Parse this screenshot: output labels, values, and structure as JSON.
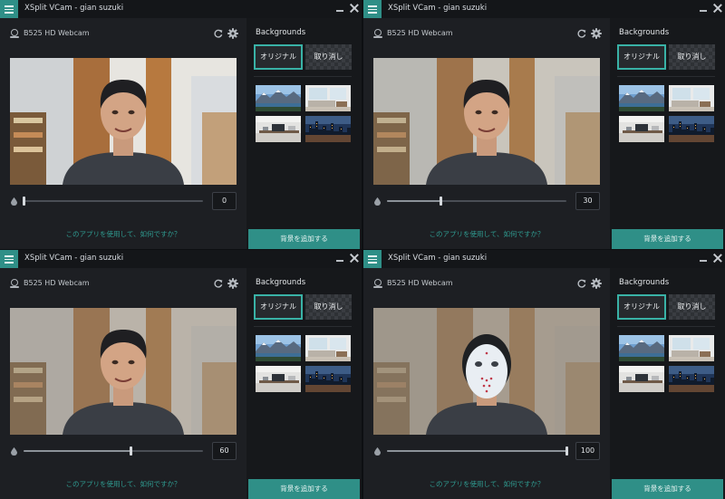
{
  "colors": {
    "accent": "#2f8f87",
    "accent_border": "#39b2a6",
    "link": "#2f9b90",
    "panel_dark": "#16181b",
    "panel": "#1d1f23"
  },
  "icons": {
    "menu": "hamburger-menu-icon",
    "minimize": "minimize-icon",
    "close": "close-icon",
    "webcam": "webcam-icon",
    "refresh": "refresh-icon",
    "settings": "gear-icon",
    "blur": "droplet-icon"
  },
  "windows": [
    {
      "title": "XSplit VCam - gian suzuki",
      "camera_name": "B525 HD Webcam",
      "blur_value": "0",
      "blur_level": 0,
      "preview": {
        "blur": 0,
        "mask": false
      },
      "feedback_text": "このアプリを使用して、如何ですか？",
      "backgrounds_title": "Backgrounds",
      "original_label": "オリジナル",
      "remove_label": "取り消し",
      "add_background_label": "背景を追加する"
    },
    {
      "title": "XSplit VCam - gian suzuki",
      "camera_name": "B525 HD Webcam",
      "blur_value": "30",
      "blur_level": 30,
      "preview": {
        "blur": 30,
        "mask": false
      },
      "feedback_text": "このアプリを使用して、如何ですか？",
      "backgrounds_title": "Backgrounds",
      "original_label": "オリジナル",
      "remove_label": "取り消し",
      "add_background_label": "背景を追加する"
    },
    {
      "title": "XSplit VCam - gian suzuki",
      "camera_name": "B525 HD Webcam",
      "blur_value": "60",
      "blur_level": 60,
      "preview": {
        "blur": 60,
        "mask": false
      },
      "feedback_text": "このアプリを使用して、如何ですか？",
      "backgrounds_title": "Backgrounds",
      "original_label": "オリジナル",
      "remove_label": "取り消し",
      "add_background_label": "背景を追加する"
    },
    {
      "title": "XSplit VCam - gian suzuki",
      "camera_name": "B525 HD Webcam",
      "blur_value": "100",
      "blur_level": 100,
      "preview": {
        "blur": 100,
        "mask": true
      },
      "feedback_text": "このアプリを使用して、如何ですか？",
      "backgrounds_title": "Backgrounds",
      "original_label": "オリジナル",
      "remove_label": "取り消し",
      "add_background_label": "背景を追加する"
    }
  ],
  "slider_max": 100,
  "background_thumbnails": [
    {
      "name": "mountain-lake-thumbnail"
    },
    {
      "name": "bright-living-room-thumbnail"
    },
    {
      "name": "desk-workspace-thumbnail"
    },
    {
      "name": "city-night-thumbnail"
    }
  ]
}
